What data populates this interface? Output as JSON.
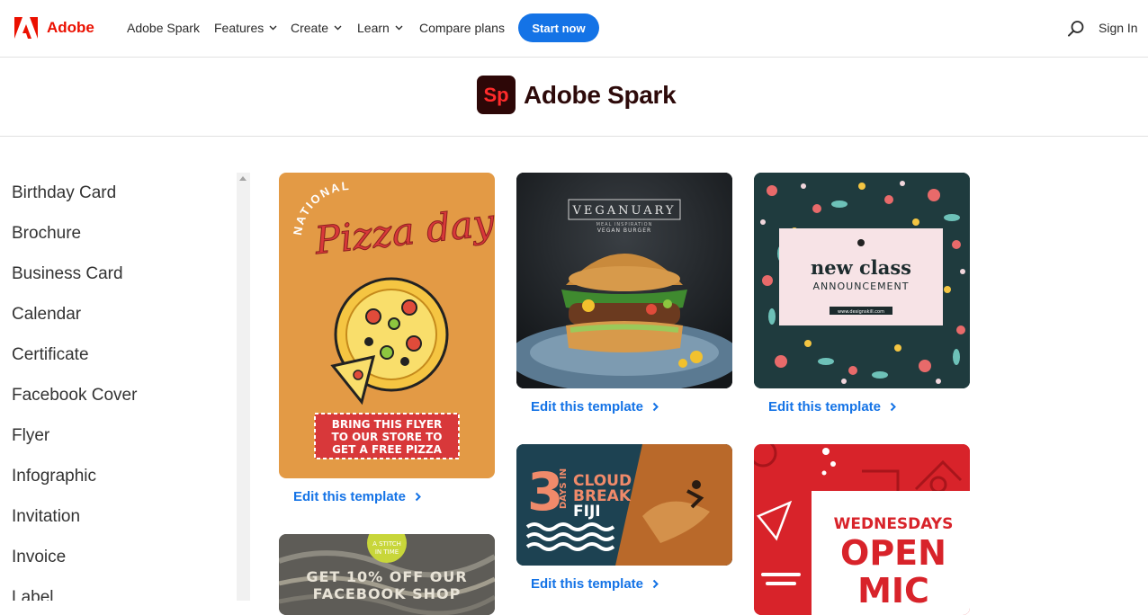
{
  "nav": {
    "brand": "Adobe",
    "items": [
      {
        "label": "Adobe Spark",
        "has_dropdown": false
      },
      {
        "label": "Features",
        "has_dropdown": true
      },
      {
        "label": "Create",
        "has_dropdown": true
      },
      {
        "label": "Learn",
        "has_dropdown": true
      },
      {
        "label": "Compare plans",
        "has_dropdown": false
      }
    ],
    "cta": "Start now",
    "sign_in": "Sign In"
  },
  "product": {
    "logo_text": "Sp",
    "title": "Adobe Spark"
  },
  "sidebar": {
    "items": [
      "Birthday Card",
      "Brochure",
      "Business Card",
      "Calendar",
      "Certificate",
      "Facebook Cover",
      "Flyer",
      "Infographic",
      "Invitation",
      "Invoice",
      "Label"
    ]
  },
  "templates": {
    "edit_label": "Edit this template",
    "pizza": {
      "arc": "NATIONAL",
      "script": "Pizza day",
      "cta_lines": [
        "BRING THIS FLYER",
        "TO OUR STORE TO",
        "GET A FREE PIZZA"
      ]
    },
    "burger": {
      "title": "VEGANUARY",
      "sub1": "MEAL INSPIRATION",
      "sub2": "VEGAN BURGER"
    },
    "newclass": {
      "title": "new class",
      "subtitle": "ANNOUNCEMENT",
      "url": "www.designskill.com"
    },
    "fiji": {
      "number": "3",
      "days": "DAYS IN",
      "line1": "CLOUD",
      "line2": "BREAK",
      "line3": "FIJI"
    },
    "knit": {
      "badge_line1": "A STITCH",
      "badge_line2": "IN TIME",
      "line1": "GET 10% OFF OUR",
      "line2": "FACEBOOK SHOP"
    },
    "mic": {
      "line1": "WEDNESDAYS",
      "line2": "OPEN",
      "line3": "MIC"
    }
  },
  "colors": {
    "accent": "#1473e6",
    "adobe_red": "#eb1000",
    "pizza_bg": "#e39a45",
    "mic_red": "#d8232a"
  }
}
